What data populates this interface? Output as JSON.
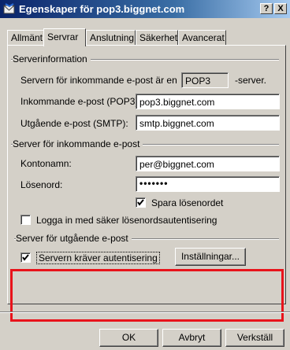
{
  "window": {
    "title": "Egenskaper för pop3.biggnet.com",
    "help_button": "?",
    "close_button": "X"
  },
  "tabs": [
    {
      "label": "Allmänt",
      "active": false
    },
    {
      "label": "Servrar",
      "active": true
    },
    {
      "label": "Anslutning",
      "active": false
    },
    {
      "label": "Säkerhet",
      "active": false
    },
    {
      "label": "Avancerat",
      "active": false
    }
  ],
  "server_info": {
    "group_label": "Serverinformation",
    "type_prefix": "Servern för inkommande e-post är en",
    "type_value": "POP3",
    "type_suffix": "-server.",
    "incoming_label": "Inkommande e-post (POP3):",
    "incoming_value": "pop3.biggnet.com",
    "outgoing_label": "Utgående e-post (SMTP):",
    "outgoing_value": "smtp.biggnet.com"
  },
  "incoming_server": {
    "group_label": "Server för inkommande e-post",
    "account_label": "Kontonamn:",
    "account_value": "per@biggnet.com",
    "password_label": "Lösenord:",
    "password_value": "•••••••",
    "remember_password_label": "Spara lösenordet",
    "remember_password_checked": true,
    "secure_auth_label": "Logga in med säker lösenordsautentisering",
    "secure_auth_checked": false
  },
  "outgoing_server": {
    "group_label": "Server för utgående e-post",
    "requires_auth_label": "Servern kräver autentisering",
    "requires_auth_checked": true,
    "settings_button": "Inställningar..."
  },
  "footer": {
    "ok_button": "OK",
    "cancel_button": "Avbryt",
    "apply_button": "Verkställ"
  },
  "colors": {
    "titlebar_start": "#0a246a",
    "titlebar_end": "#a6caf0",
    "dialog_background": "#d4d0c8",
    "highlight_box": "#e8131b"
  }
}
